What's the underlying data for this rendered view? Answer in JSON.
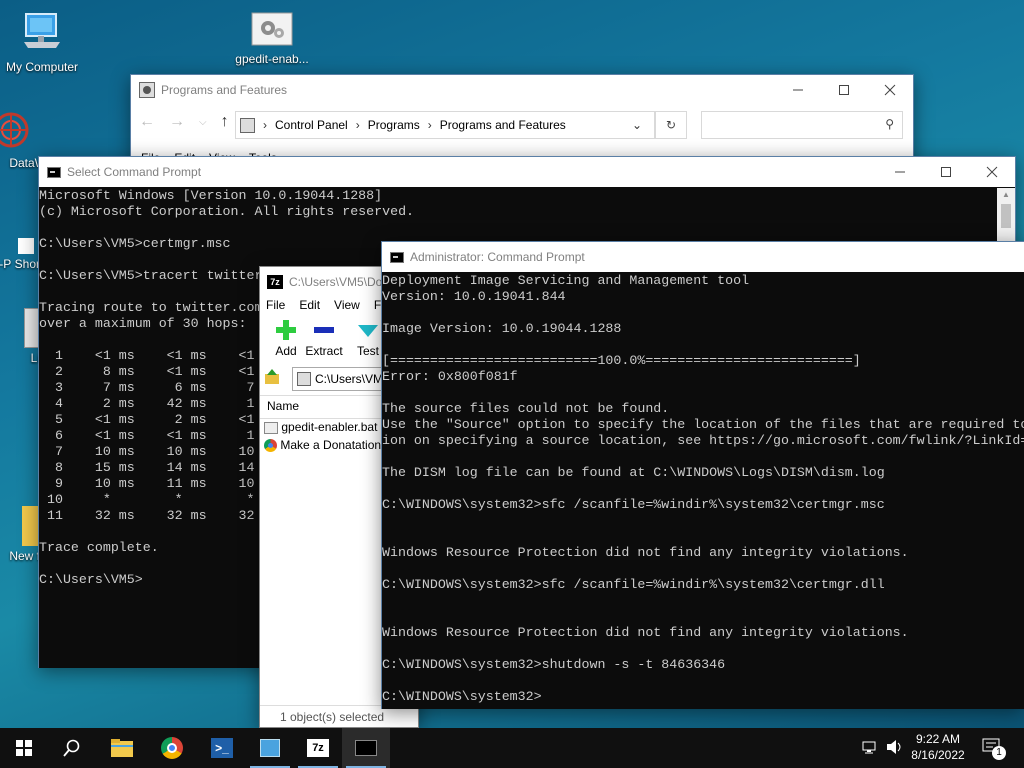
{
  "desktop": {
    "icons": [
      {
        "label": "My Computer"
      },
      {
        "label": "gpedit-enab..."
      },
      {
        "label": "DataW"
      },
      {
        "label": "Ф-Р Shor"
      },
      {
        "label": "Li"
      },
      {
        "label": "New f"
      }
    ]
  },
  "programs_window": {
    "title": "Programs and Features",
    "breadcrumb": [
      "Control Panel",
      "Programs",
      "Programs and Features"
    ],
    "menu": [
      "File",
      "Edit",
      "View",
      "Tools"
    ],
    "search_placeholder": ""
  },
  "select_cmd": {
    "title": "Select Command Prompt",
    "lines": [
      "Microsoft Windows [Version 10.0.19044.1288]",
      "(c) Microsoft Corporation. All rights reserved.",
      "",
      "C:\\Users\\VM5>certmgr.msc",
      "",
      "C:\\Users\\VM5>tracert twitter",
      "",
      "Tracing route to twitter.com",
      "over a maximum of 30 hops:",
      "",
      "  1    <1 ms    <1 ms    <1",
      "  2     8 ms    <1 ms    <1",
      "  3     7 ms     6 ms     7",
      "  4     2 ms    42 ms     1",
      "  5    <1 ms     2 ms    <1",
      "  6    <1 ms    <1 ms     1",
      "  7    10 ms    10 ms    10",
      "  8    15 ms    14 ms    14",
      "  9    10 ms    11 ms    10",
      " 10     *        *        *",
      " 11    32 ms    32 ms    32",
      "",
      "Trace complete.",
      "",
      "C:\\Users\\VM5>"
    ]
  },
  "sevenzip": {
    "title": "C:\\Users\\VM5\\Do",
    "menu": [
      "File",
      "Edit",
      "View",
      "Fa"
    ],
    "toolbar": [
      "Add",
      "Extract",
      "Test"
    ],
    "path": "C:\\Users\\VM",
    "column_name": "Name",
    "files": [
      "gpedit-enabler.bat",
      "Make a Donatation"
    ],
    "status": "1 object(s) selected"
  },
  "admin_cmd": {
    "title": "Administrator: Command Prompt",
    "lines": [
      "Deployment Image Servicing and Management tool",
      "Version: 10.0.19041.844",
      "",
      "Image Version: 10.0.19044.1288",
      "",
      "[==========================100.0%==========================]",
      "Error: 0x800f081f",
      "",
      "The source files could not be found.",
      "Use the \"Source\" option to specify the location of the files that are required to",
      "ion on specifying a source location, see https://go.microsoft.com/fwlink/?LinkId=",
      "",
      "The DISM log file can be found at C:\\WINDOWS\\Logs\\DISM\\dism.log",
      "",
      "C:\\WINDOWS\\system32>sfc /scanfile=%windir%\\system32\\certmgr.msc",
      "",
      "",
      "Windows Resource Protection did not find any integrity violations.",
      "",
      "C:\\WINDOWS\\system32>sfc /scanfile=%windir%\\system32\\certmgr.dll",
      "",
      "",
      "Windows Resource Protection did not find any integrity violations.",
      "",
      "C:\\WINDOWS\\system32>shutdown -s -t 84636346",
      "",
      "C:\\WINDOWS\\system32>"
    ]
  },
  "taskbar": {
    "time": "9:22 AM",
    "date": "8/16/2022",
    "notification_count": "1"
  },
  "colors": {
    "console_bg": "#0c0c0c",
    "console_fg": "#cccccc",
    "taskbar_bg": "#101010",
    "accent": "#7fb4e3"
  }
}
